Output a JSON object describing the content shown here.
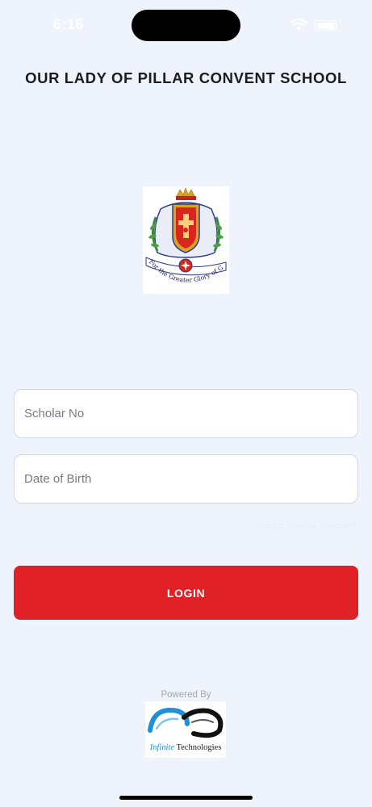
{
  "status_bar": {
    "time": "6:16",
    "icons": [
      "wifi-icon",
      "battery-icon"
    ]
  },
  "header": {
    "title": "OUR LADY OF PILLAR CONVENT SCHOOL"
  },
  "logo": {
    "motto": "For the Greater Glory of God",
    "colors": {
      "red": "#d9261c",
      "blue": "#2e3a8c",
      "green": "#3b8a3a",
      "gold": "#d9a520"
    }
  },
  "form": {
    "scholar_no_placeholder": "Scholar No",
    "scholar_no_value": "",
    "dob_placeholder": "Date of Birth",
    "dob_value": "",
    "forgot_text": "Forgot Scholar Number?",
    "login_label": "LOGIN"
  },
  "footer": {
    "powered_by": "Powered By",
    "company_name_accent": "Infinite",
    "company_name_rest": " Technologies"
  },
  "colors": {
    "background": "#eef3fc",
    "primary_button": "#df2126",
    "input_border": "#cfd6e6"
  }
}
